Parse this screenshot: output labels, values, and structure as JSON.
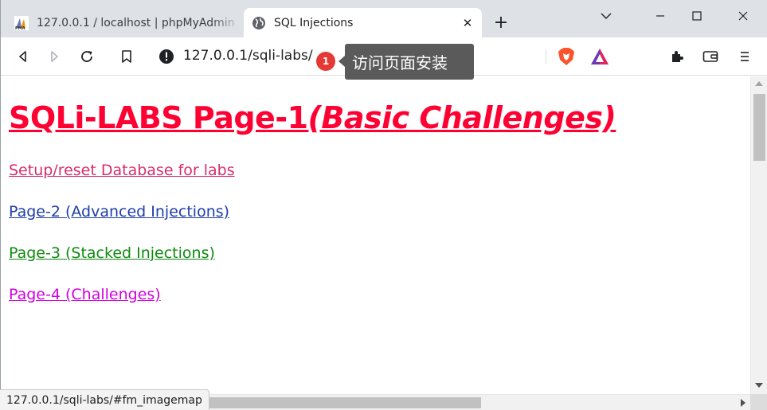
{
  "browser": {
    "tabs": [
      {
        "title": "127.0.0.1 / localhost | phpMyAdmin",
        "active": false,
        "favicon": "phpmyadmin-icon"
      },
      {
        "title": "SQL Injections",
        "active": true,
        "favicon": "globe-icon"
      }
    ],
    "new_tab": "+",
    "address": "127.0.0.1/sqli-labs/",
    "notification_count": "1",
    "tooltip": "访问页面安装",
    "status_url": "127.0.0.1/sqli-labs/#fm_imagemap"
  },
  "page": {
    "title_main": "SQLi-LABS Page-1",
    "title_sub": "(Basic Challenges)",
    "links": [
      {
        "label": "Setup/reset Database for labs",
        "color": "#d62d6e"
      },
      {
        "label": "Page-2 (Advanced Injections)",
        "color": "#1f3ea8"
      },
      {
        "label": "Page-3 (Stacked Injections)",
        "color": "#0f8a0f"
      },
      {
        "label": "Page-4 (Challenges)",
        "color": "#d100e0"
      }
    ]
  },
  "colors": {
    "title": "#ff0033",
    "badge": "#e53935",
    "tooltip_bg": "#5a5a5a",
    "tabstrip": "#dee1e6"
  }
}
